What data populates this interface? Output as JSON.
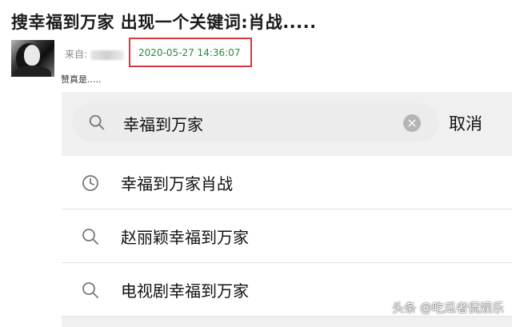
{
  "article": {
    "title": "搜幸福到万家 出现一个关键词:肖战.....",
    "from_label": "来自:",
    "timestamp": "2020-05-27 14:36:07",
    "snippet": "赞真是....."
  },
  "search": {
    "query": "幸福到万家",
    "clear_icon": "clear-icon",
    "cancel_label": "取消"
  },
  "suggestions": [
    {
      "icon": "clock-icon",
      "text": "幸福到万家肖战"
    },
    {
      "icon": "search-icon",
      "text": "赵丽颖幸福到万家"
    },
    {
      "icon": "search-icon",
      "text": "电视剧幸福到万家"
    }
  ],
  "watermark": "头条 @吃瓜者侃娱乐",
  "colors": {
    "highlight_border": "#d9363e",
    "timestamp_text": "#2c8a3a"
  }
}
